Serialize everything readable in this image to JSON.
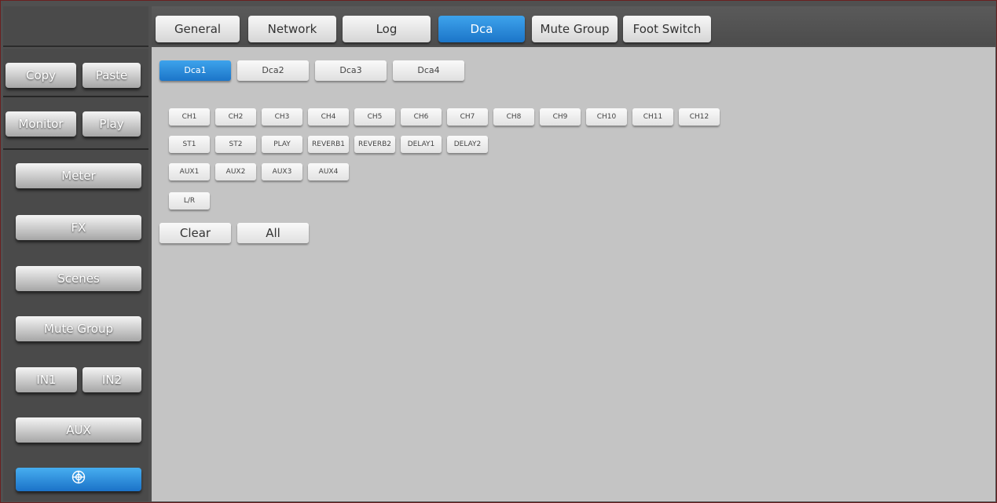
{
  "top_tabs": [
    {
      "label": "General"
    },
    {
      "label": "Network"
    },
    {
      "label": "Log"
    },
    {
      "label": "Dca",
      "active": true
    },
    {
      "label": "Mute Group"
    },
    {
      "label": "Foot Switch"
    }
  ],
  "sidebar": {
    "copy_label": "Copy",
    "paste_label": "Paste",
    "monitor_label": "Monitor",
    "play_label": "Play",
    "meter_label": "Meter",
    "fx_label": "FX",
    "scenes_label": "Scenes",
    "mute_group_label": "Mute Group",
    "in1_label": "IN1",
    "in2_label": "IN2",
    "aux_label": "AUX",
    "bottom_icon": "target-crosshair-icon"
  },
  "dca": {
    "tabs": [
      {
        "label": "Dca1",
        "active": true
      },
      {
        "label": "Dca2"
      },
      {
        "label": "Dca3"
      },
      {
        "label": "Dca4"
      }
    ],
    "channel_rows": [
      [
        "CH1",
        "CH2",
        "CH3",
        "CH4",
        "CH5",
        "CH6",
        "CH7",
        "CH8",
        "CH9",
        "CH10",
        "CH11",
        "CH12"
      ],
      [
        "ST1",
        "ST2",
        "PLAY",
        "REVERB1",
        "REVERB2",
        "DELAY1",
        "DELAY2"
      ],
      [
        "AUX1",
        "AUX2",
        "AUX3",
        "AUX4"
      ],
      [
        "L/R"
      ]
    ],
    "clear_label": "Clear",
    "all_label": "All"
  },
  "colors": {
    "accent_blue": "#1c75c8",
    "panel_bg": "#c4c4c4",
    "sidebar_bg": "#4a4a4a",
    "frame_border": "#6a2020"
  }
}
